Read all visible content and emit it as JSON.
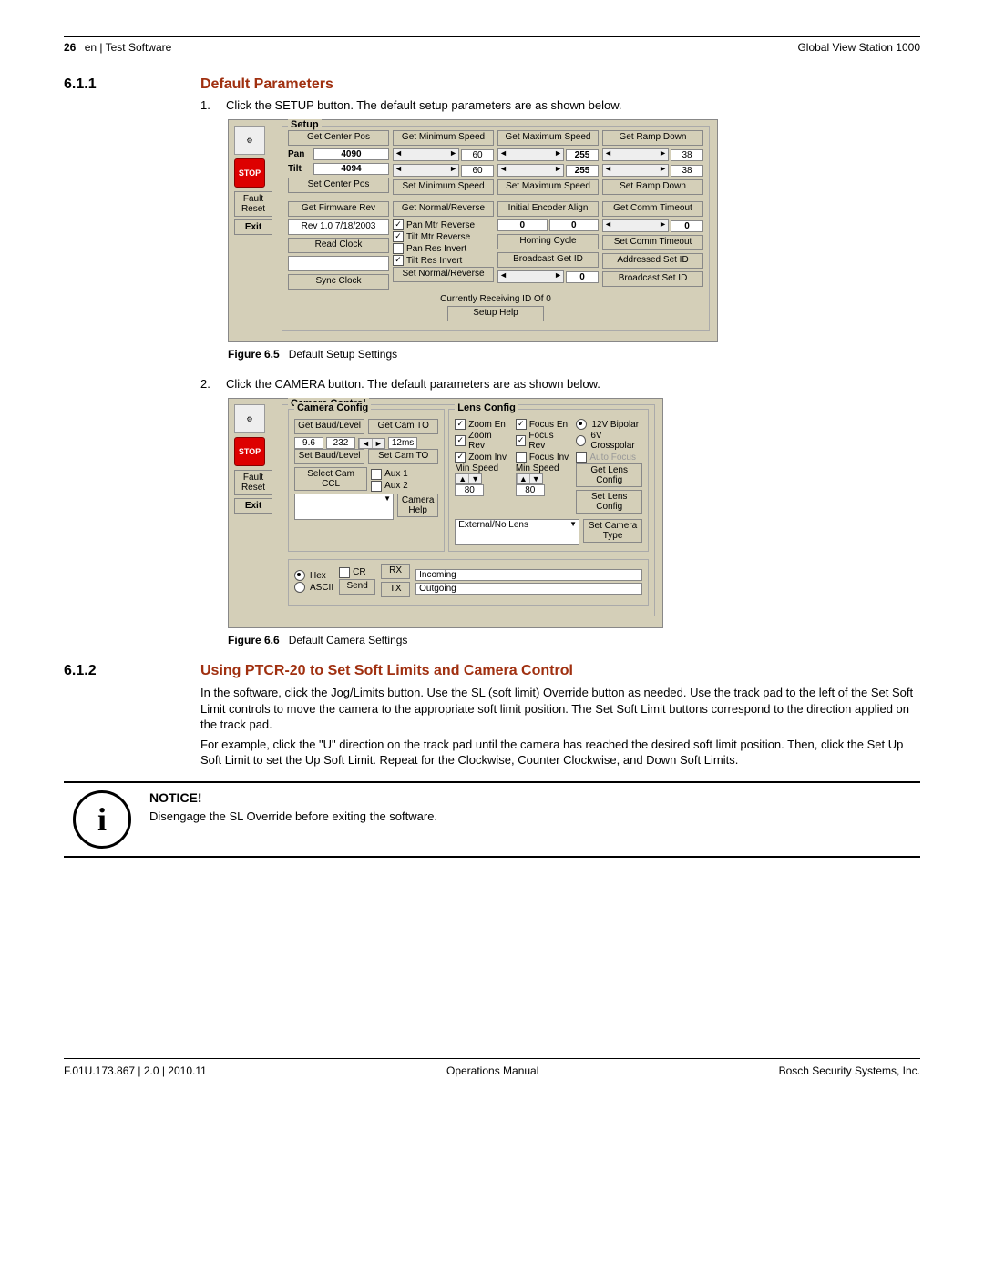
{
  "header": {
    "page_num": "26",
    "breadcrumb": "en | Test Software",
    "right": "Global View Station 1000"
  },
  "sec611": {
    "num": "6.1.1",
    "title": "Default Parameters",
    "item1_num": "1.",
    "item1_text": "Click the SETUP button. The default setup parameters are as shown below.",
    "item2_num": "2.",
    "item2_text": "Click the CAMERA button. The default parameters are as shown below."
  },
  "fig65": {
    "label": "Figure 6.5",
    "caption": "Default Setup Settings"
  },
  "fig66": {
    "label": "Figure 6.6",
    "caption": "Default Camera Settings"
  },
  "ss_sidebar": {
    "stop": "STOP",
    "fault_reset": "Fault Reset",
    "exit": "Exit"
  },
  "setup": {
    "title": "Setup",
    "get_center_pos": "Get Center Pos",
    "get_min_speed": "Get Minimum Speed",
    "get_max_speed": "Get Maximum Speed",
    "get_ramp_down": "Get Ramp Down",
    "pan_label": "Pan",
    "pan_center": "4090",
    "pan_min": "60",
    "pan_max": "255",
    "pan_ramp": "38",
    "tilt_label": "Tilt",
    "tilt_center": "4094",
    "tilt_min": "60",
    "tilt_max": "255",
    "tilt_ramp": "38",
    "set_center_pos": "Set Center Pos",
    "set_min_speed": "Set Minimum Speed",
    "set_max_speed": "Set Maximum Speed",
    "set_ramp_down": "Set Ramp Down",
    "get_firmware": "Get Firmware Rev",
    "firmware_val": "Rev 1.0  7/18/2003",
    "read_clock": "Read Clock",
    "sync_clock": "Sync Clock",
    "get_normal_rev": "Get Normal/Reverse",
    "pan_mtr_rev": "Pan Mtr Reverse",
    "tilt_mtr_rev": "Tilt Mtr Reverse",
    "pan_res_inv": "Pan Res Invert",
    "tilt_res_inv": "Tilt Res Invert",
    "set_normal_rev": "Set Normal/Reverse",
    "initial_enc": "Initial Encoder Align",
    "enc_a": "0",
    "enc_b": "0",
    "homing_cycle": "Homing Cycle",
    "broadcast_get": "Broadcast Get ID",
    "broadcast_val": "0",
    "current_rx": "Currently Receiving ID Of 0",
    "get_comm_to": "Get Comm Timeout",
    "comm_to_val": "0",
    "set_comm_to": "Set Comm Timeout",
    "addressed_set": "Addressed Set ID",
    "broadcast_set": "Broadcast Set ID",
    "setup_help": "Setup Help"
  },
  "cam": {
    "title": "Camera Control",
    "cam_config": "Camera Config",
    "lens_config": "Lens Config",
    "get_baud": "Get Baud/Level",
    "get_cam_to": "Get Cam TO",
    "baud_val": "9.6",
    "proto_val": "232",
    "to_val": "12ms",
    "set_baud": "Set Baud/Level",
    "set_cam_to": "Set Cam TO",
    "select_ccl": "Select Cam CCL",
    "aux1": "Aux 1",
    "aux2": "Aux 2",
    "cam_help": "Camera Help",
    "zoom_en": "Zoom En",
    "zoom_rev": "Zoom Rev",
    "zoom_inv": "Zoom Inv",
    "focus_en": "Focus En",
    "focus_rev": "Focus Rev",
    "focus_inv": "Focus Inv",
    "bipolar12": "12V Bipolar",
    "crosspolar6": "6V Crosspolar",
    "auto_focus": "Auto Focus",
    "min_speed": "Min Speed",
    "min_speed_a": "80",
    "min_speed_b": "80",
    "get_lens": "Get Lens Config",
    "set_lens": "Set Lens Config",
    "set_cam_type": "Set Camera Type",
    "lens_sel": "External/No Lens",
    "hex": "Hex",
    "ascii": "ASCII",
    "cr": "CR",
    "rx": "RX",
    "rx_val": "Incoming",
    "send": "Send",
    "tx": "TX",
    "tx_val": "Outgoing"
  },
  "sec612": {
    "num": "6.1.2",
    "title": "Using PTCR-20 to Set Soft Limits and Camera Control",
    "p1": "In the software, click the Jog/Limits button. Use the SL (soft limit) Override button as needed. Use the track pad to the left of the Set Soft Limit controls to move the camera to the appropriate soft limit position. The Set Soft Limit buttons correspond to the direction applied on the track pad.",
    "p2": "For example, click the \"U\" direction on the track pad until the camera has reached the desired soft limit position. Then, click the Set Up Soft Limit to set the Up Soft Limit. Repeat for the Clockwise, Counter Clockwise, and Down Soft Limits."
  },
  "notice": {
    "title": "NOTICE!",
    "text": "Disengage the SL Override before exiting the software."
  },
  "footer": {
    "left": "F.01U.173.867 | 2.0 | 2010.11",
    "center": "Operations Manual",
    "right": "Bosch Security Systems, Inc."
  }
}
